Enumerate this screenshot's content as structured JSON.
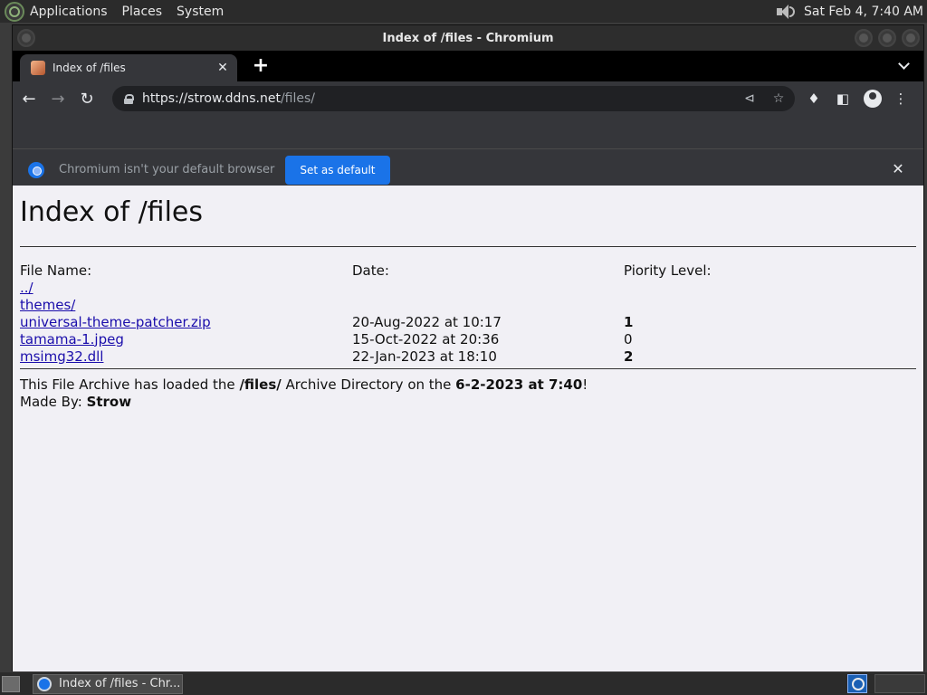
{
  "desktop": {
    "menus": [
      "Applications",
      "Places",
      "System"
    ],
    "clock": "Sat Feb  4,  7:40 AM"
  },
  "window": {
    "title": "Index of /files - Chromium"
  },
  "browser": {
    "tab_title": "Index of /files",
    "new_tab": "+",
    "tab_close": "✕",
    "url_host": "https://strow.ddns.net",
    "url_path": "/files/",
    "infobar_text": "Chromium isn't your default browser",
    "infobar_button": "Set as default",
    "infobar_close": "✕"
  },
  "page": {
    "heading": "Index of /files",
    "columns": [
      "File Name:",
      "Date:",
      "Piority Level:"
    ],
    "rows": [
      {
        "name": "../",
        "date": "",
        "priority": "",
        "bold": false
      },
      {
        "name": "themes/",
        "date": "",
        "priority": "",
        "bold": false
      },
      {
        "name": "universal-theme-patcher.zip",
        "date": "20-Aug-2022 at 10:17",
        "priority": "1",
        "bold": true
      },
      {
        "name": "tamama-1.jpeg",
        "date": "15-Oct-2022 at 20:36",
        "priority": "0",
        "bold": false
      },
      {
        "name": "msimg32.dll",
        "date": "22-Jan-2023 at 18:10",
        "priority": "2",
        "bold": true
      }
    ],
    "footer": {
      "line1_pre": "This File Archive has loaded the ",
      "line1_dir": "/files/",
      "line1_mid": " Archive Directory on the ",
      "line1_date": "6-2-2023 at 7:40",
      "line1_end": "!",
      "line2_pre": "Made By: ",
      "line2_author": "Strow"
    }
  },
  "taskbar": {
    "task_label": "Index of /files - Chr..."
  },
  "colors": {
    "accent": "#1a73e8",
    "page_bg": "#f1f0f5",
    "link": "#1a0dab"
  }
}
